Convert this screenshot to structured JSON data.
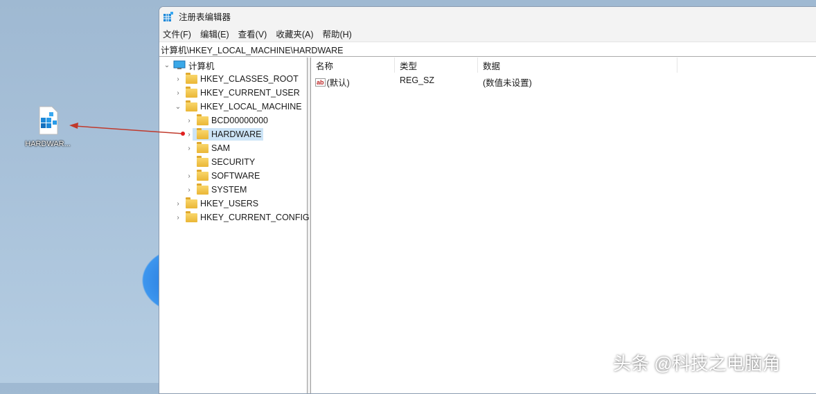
{
  "window": {
    "title": "注册表编辑器"
  },
  "menu": [
    "文件(F)",
    "编辑(E)",
    "查看(V)",
    "收藏夹(A)",
    "帮助(H)"
  ],
  "address": "计算机\\HKEY_LOCAL_MACHINE\\HARDWARE",
  "tree": {
    "root": "计算机",
    "hives": [
      "HKEY_CLASSES_ROOT",
      "HKEY_CURRENT_USER",
      "HKEY_LOCAL_MACHINE",
      "HKEY_USERS",
      "HKEY_CURRENT_CONFIG"
    ],
    "hklm_children": [
      "BCD00000000",
      "HARDWARE",
      "SAM",
      "SECURITY",
      "SOFTWARE",
      "SYSTEM"
    ]
  },
  "list": {
    "columns": [
      "名称",
      "类型",
      "数据"
    ],
    "rows": [
      {
        "name": "(默认)",
        "type": "REG_SZ",
        "data": "(数值未设置)"
      }
    ]
  },
  "desktop": {
    "icon_label": "HARDWAR..."
  },
  "watermark": "头条 @科技之电脑角"
}
